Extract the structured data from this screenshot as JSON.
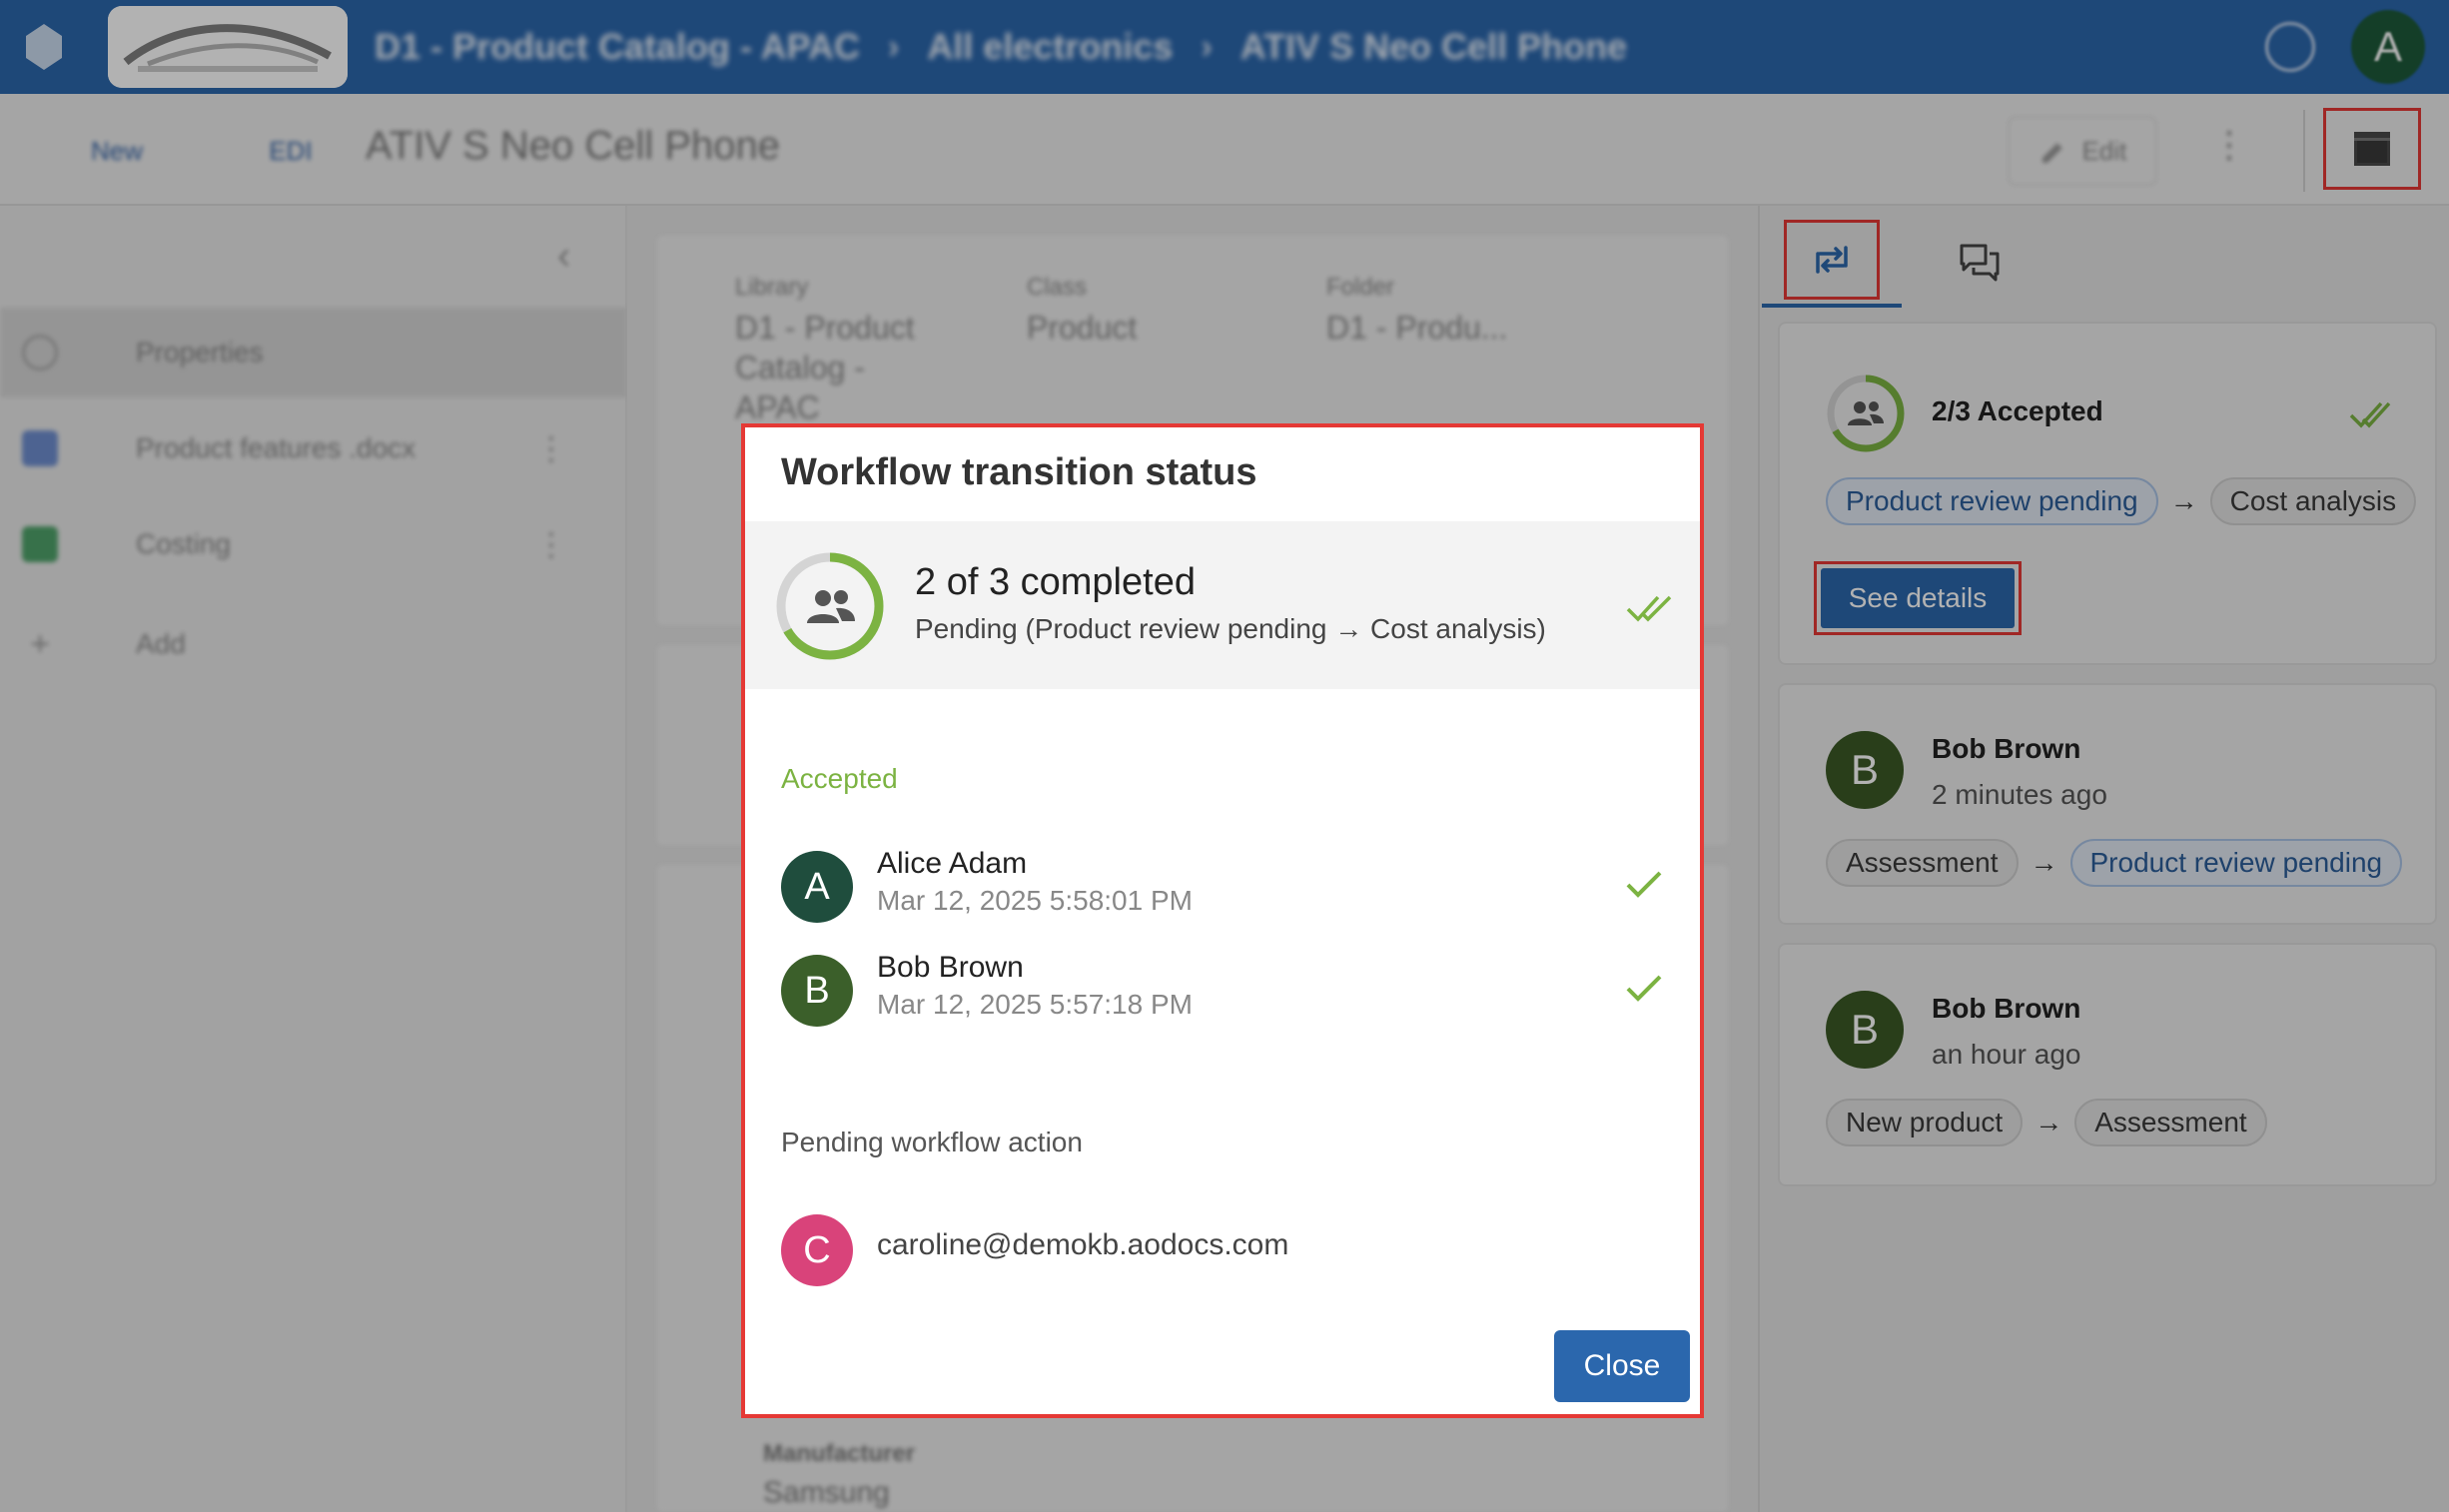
{
  "topbar": {
    "breadcrumbs": [
      "D1 - Product Catalog - APAC",
      "All electronics",
      "ATIV S Neo Cell Phone"
    ],
    "avatar_letter": "A",
    "colors": {
      "bar": "#2b67ad"
    }
  },
  "toolbar": {
    "new_label": "New",
    "short_label": "EDI",
    "document_title": "ATIV S Neo Cell Phone",
    "edit_label": "Edit",
    "more_icon": "more-vert-icon",
    "panel_icon": "panel-toggle-icon"
  },
  "sidebar": {
    "items": [
      {
        "label": "Properties",
        "icon": "info-icon"
      },
      {
        "label": "Product features .docx",
        "icon": "doc-icon"
      },
      {
        "label": "Costing",
        "icon": "sheet-icon"
      },
      {
        "label": "Add",
        "icon": "plus-icon"
      }
    ]
  },
  "center": {
    "library_key": "Library",
    "library_value": "D1 - Product Catalog - APAC",
    "class_key": "Class",
    "class_value": "Product",
    "folder_key": "Folder",
    "folder_value": "D1 - Produ...",
    "manufacturer_key": "Manufacturer",
    "manufacturer_value": "Samsung"
  },
  "right_panel": {
    "tabs": [
      "workflow-history-icon",
      "comments-icon"
    ],
    "summary": {
      "label": "2/3 Accepted",
      "from": "Product review pending",
      "arrow": "→",
      "to": "Cost analysis",
      "button": "See details"
    },
    "history": [
      {
        "avatar": "B",
        "name": "Bob Brown",
        "time": "2 minutes ago",
        "from": "Assessment",
        "arrow": "→",
        "to": "Product review pending"
      },
      {
        "avatar": "B",
        "name": "Bob Brown",
        "time": "an hour ago",
        "from": "New product",
        "arrow": "→",
        "to": "Assessment"
      }
    ]
  },
  "modal": {
    "title": "Workflow transition status",
    "status_main": "2 of 3 completed",
    "status_sub": "Pending  (Product review pending → Cost analysis)",
    "progress_fraction": 0.6667,
    "accepted_heading": "Accepted",
    "accepted": [
      {
        "avatar": "A",
        "name": "Alice Adam",
        "date": "Mar 12, 2025 5:58:01 PM",
        "color": "#1f4d3d"
      },
      {
        "avatar": "B",
        "name": "Bob Brown",
        "date": "Mar 12, 2025 5:57:18 PM",
        "color": "#3b5f2a"
      }
    ],
    "pending_heading": "Pending workflow action",
    "pending": [
      {
        "avatar": "C",
        "email": "caroline@demokb.aodocs.com",
        "color": "#d9437a"
      }
    ],
    "close_label": "Close",
    "colors": {
      "accent": "#2b67ad",
      "accepted": "#7cb342",
      "highlight": "#e53935"
    }
  }
}
